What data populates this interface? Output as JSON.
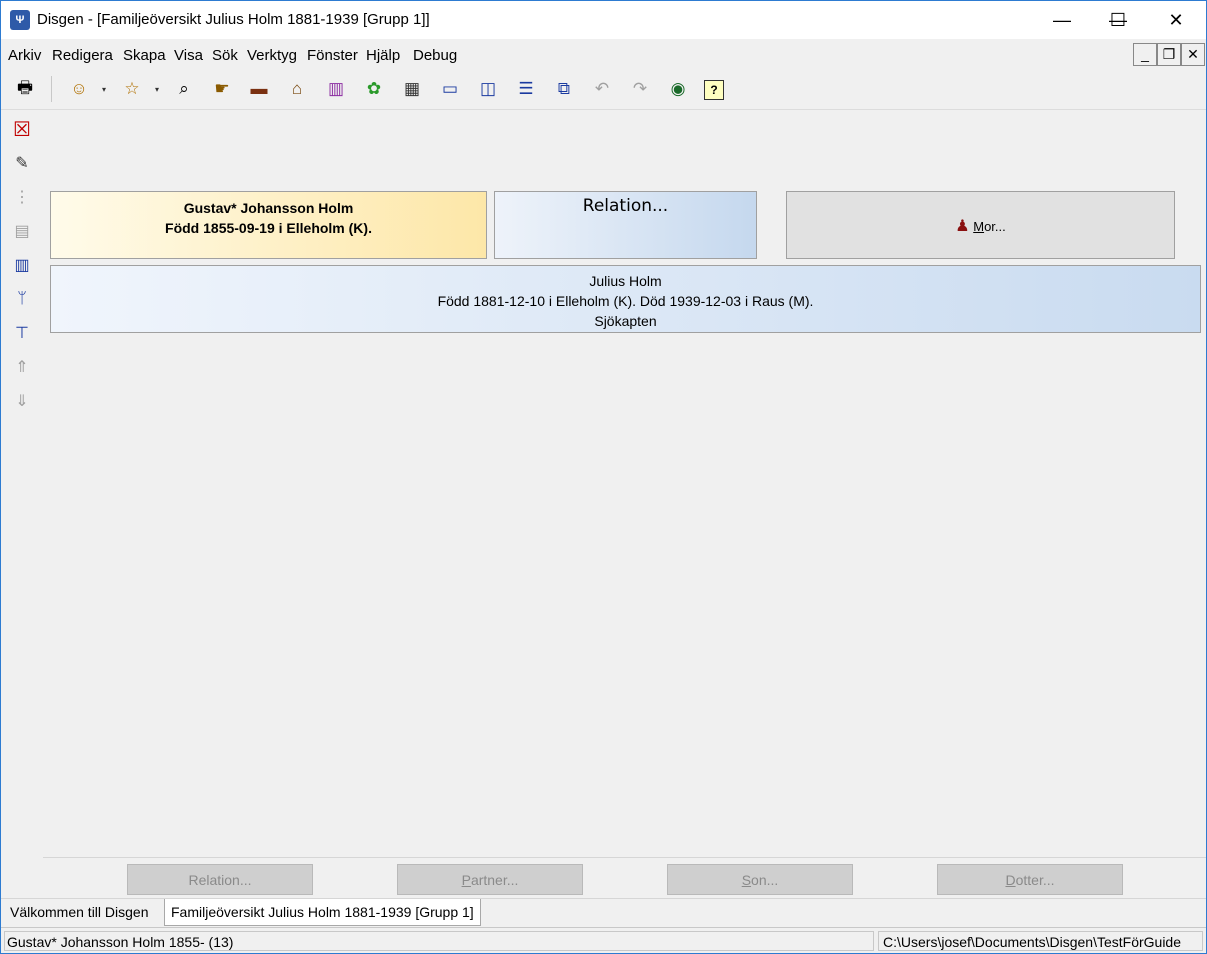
{
  "window": {
    "app_icon_glyph": "Ψ",
    "title": "Disgen - [Familjeöversikt Julius Holm 1881-1939 [Grupp 1]]",
    "minimize": "—",
    "maximize": "☐",
    "close": "✕"
  },
  "menu": {
    "items": [
      "Arkiv",
      "Redigera",
      "Skapa",
      "Visa",
      "Sök",
      "Verktyg",
      "Fönster",
      "Hjälp",
      "Debug"
    ]
  },
  "mdi_controls": {
    "minimize": "_",
    "restore": "❐",
    "close": "✕"
  },
  "toolbar": {
    "icons": {
      "print": "🖶",
      "person": "☺",
      "person_search": "☆",
      "binoculars": "⌕",
      "hand": "☛",
      "book": "▬",
      "home": "⌂",
      "books": "▥",
      "map": "✿",
      "calendar": "▦",
      "window1": "▭",
      "window2": "◫",
      "window3": "☰",
      "window4": "⧉",
      "undo": "↶",
      "redo": "↷",
      "globe": "◉",
      "help": "?"
    },
    "dropdown_glyph": "▾"
  },
  "sidebar": {
    "icons": [
      "☒",
      "✎",
      "⋮",
      "▤",
      "▥",
      "ᛘ",
      "⊤",
      "⇑",
      "⇓"
    ],
    "colors": [
      "#c00000",
      "#333333",
      "#a0a0a0",
      "#a0a0a0",
      "#1a3aa0",
      "#1a3aa0",
      "#1a3aa0",
      "#a0a0a0",
      "#a0a0a0"
    ]
  },
  "family": {
    "father": {
      "name": "Gustav* Johansson Holm",
      "info": "Född 1855-09-19 i Elleholm (K)."
    },
    "relation_label": "Relation...",
    "mother": {
      "icon": "♟",
      "label_ul": "M",
      "label_rest": "or..."
    },
    "main_person": {
      "name": "Julius Holm",
      "info": "Född 1881-12-10 i Elleholm (K). Död 1939-12-03 i Raus (M).",
      "occupation": "Sjökapten"
    }
  },
  "bottom_buttons": {
    "relation": {
      "ul": "",
      "rest": "Relation..."
    },
    "partner": {
      "ul": "P",
      "rest": "artner..."
    },
    "son": {
      "ul": "S",
      "rest": "on..."
    },
    "daughter": {
      "ul": "D",
      "rest": "otter..."
    }
  },
  "tabs": [
    "Välkommen till Disgen",
    "Familjeöversikt Julius Holm 1881-1939 [Grupp 1]"
  ],
  "status": {
    "left": "Gustav* Johansson Holm 1855- (13)",
    "right": "C:\\Users\\josef\\Documents\\Disgen\\TestFörGuide"
  },
  "colors": {
    "father_box": "#fde7a8",
    "person_box": "#c9dbf0",
    "accent": "#2e5aa8"
  }
}
